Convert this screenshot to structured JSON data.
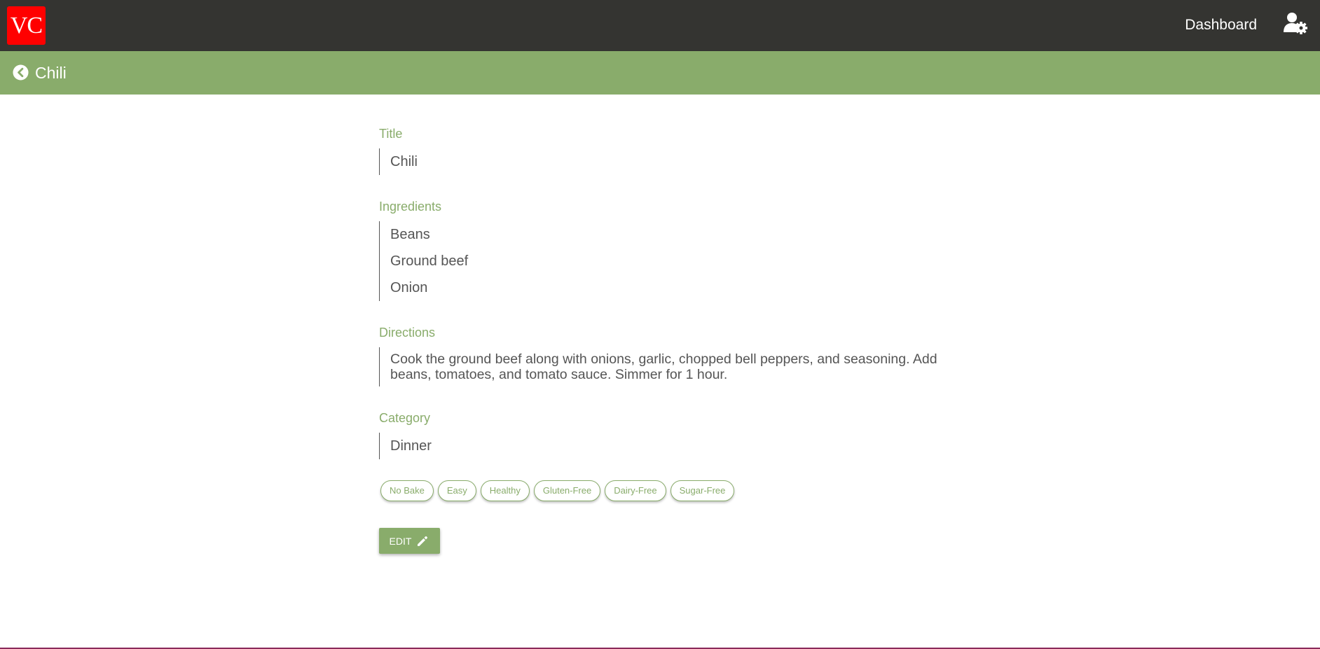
{
  "navbar": {
    "logo_text": "VC",
    "dashboard_label": "Dashboard",
    "colors": {
      "background": "#343431",
      "logo": "#ff0000"
    },
    "settings_icon": "user-gear-icon"
  },
  "titlebar": {
    "title": "Chili",
    "back_icon": "chevron-left-circle-icon",
    "color": "#89ac6b"
  },
  "recipe": {
    "title_label": "Title",
    "title_value": "Chili",
    "ingredients_label": "Ingredients",
    "ingredients": [
      "Beans",
      "Ground beef",
      "Onion"
    ],
    "directions_label": "Directions",
    "directions": "Cook the ground beef along with onions, garlic, chopped bell peppers, and seasoning. Add beans, tomatoes, and tomato sauce. Simmer for 1 hour.",
    "category_label": "Category",
    "category_value": "Dinner",
    "tags": [
      "No Bake",
      "Easy",
      "Healthy",
      "Gluten-Free",
      "Dairy-Free",
      "Sugar-Free"
    ]
  },
  "actions": {
    "edit_label": "EDIT",
    "edit_icon": "pencil-icon"
  }
}
